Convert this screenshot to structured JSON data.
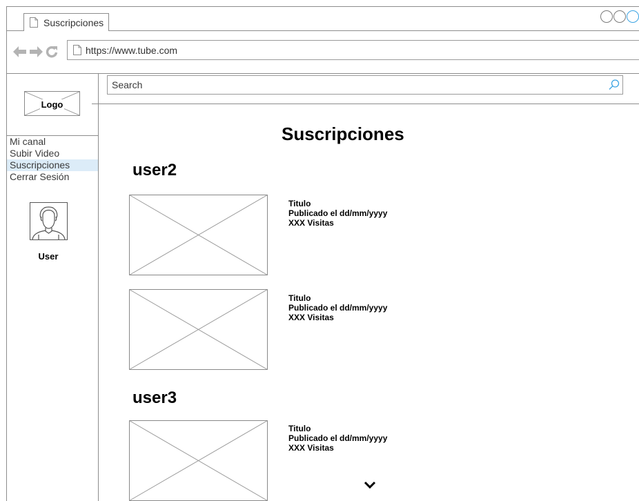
{
  "browser": {
    "tab_title": "Suscripciones",
    "url": "https://www.tube.com"
  },
  "sidebar": {
    "logo": "Logo",
    "items": [
      {
        "label": "Mi canal",
        "selected": false
      },
      {
        "label": "Subir Video",
        "selected": false
      },
      {
        "label": "Suscripciones",
        "selected": true
      },
      {
        "label": "Cerrar Sesión",
        "selected": false
      }
    ],
    "user_label": "User"
  },
  "search": {
    "placeholder": "Search"
  },
  "main": {
    "title": "Suscripciones",
    "groups": [
      {
        "user": "user2",
        "videos": [
          {
            "title": "Titulo",
            "published": "Publicado el dd/mm/yyyy",
            "views": "XXX Visitas"
          },
          {
            "title": "Titulo",
            "published": "Publicado el dd/mm/yyyy",
            "views": "XXX Visitas"
          }
        ]
      },
      {
        "user": "user3",
        "videos": [
          {
            "title": "Titulo",
            "published": "Publicado el dd/mm/yyyy",
            "views": "XXX Visitas"
          }
        ]
      }
    ]
  },
  "colors": {
    "border": "#8c8c8c",
    "selected_bg": "#dcecf8",
    "accent": "#3aa3e3"
  },
  "icons": {
    "tab": "page-icon",
    "back": "back-arrow-icon",
    "forward": "forward-arrow-icon",
    "reload": "reload-icon",
    "search": "search-icon",
    "more": "chevron-down-icon"
  }
}
